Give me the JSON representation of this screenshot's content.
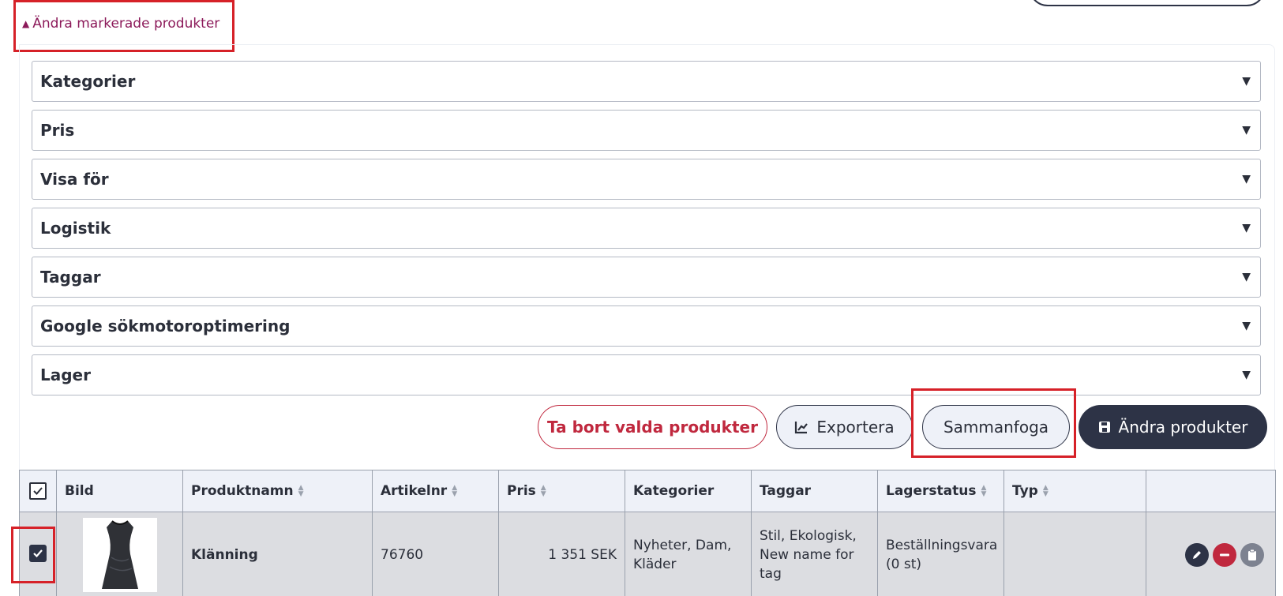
{
  "toggle": {
    "label": "Ändra markerade produkter",
    "icon": "triangle-up-icon",
    "color": "#8c1a5a"
  },
  "sections": [
    {
      "label": "Kategorier"
    },
    {
      "label": "Pris"
    },
    {
      "label": "Visa för"
    },
    {
      "label": "Logistik"
    },
    {
      "label": "Taggar"
    },
    {
      "label": "Google sökmotoroptimering"
    },
    {
      "label": "Lager"
    }
  ],
  "actions": {
    "delete_label": "Ta bort valda produkter",
    "export_label": "Exportera",
    "merge_label": "Sammanfoga",
    "save_label": "Ändra produkter"
  },
  "table": {
    "columns": [
      "Bild",
      "Produktnamn",
      "Artikelnr",
      "Pris",
      "Kategorier",
      "Taggar",
      "Lagerstatus",
      "Typ"
    ],
    "rows": [
      {
        "checked": true,
        "name": "Klänning",
        "sku": "76760",
        "price": "1 351 SEK",
        "categories": "Nyheter, Dam, Kläder",
        "tags": "Stil, Ekologisk, New name for tag",
        "stock": "Beställningsvara (0 st)",
        "type": ""
      }
    ]
  },
  "colors": {
    "primary": "#2d3346",
    "danger": "#c0283e",
    "accent": "#8c1a5a",
    "highlight": "#d62128"
  }
}
